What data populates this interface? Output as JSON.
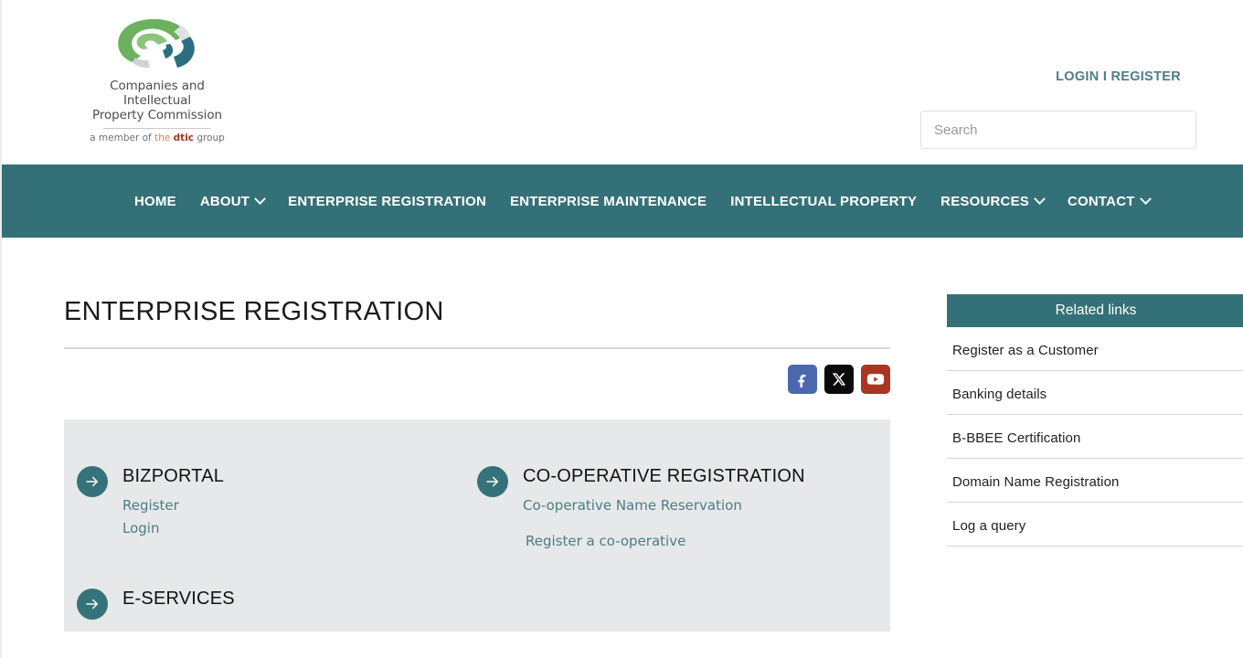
{
  "header": {
    "logo": {
      "name_line1": "Companies and Intellectual",
      "name_line2": "Property Commission",
      "tagline_prefix": "a member of ",
      "tagline_the": "the ",
      "tagline_dtic": "dtic",
      "tagline_suffix": " group",
      "icon": "cipc-swirl-logo"
    },
    "login_register": "LOGIN I REGISTER",
    "search": {
      "placeholder": "Search",
      "value": ""
    }
  },
  "nav": {
    "items": [
      {
        "label": "HOME",
        "has_caret": false
      },
      {
        "label": "ABOUT",
        "has_caret": true
      },
      {
        "label": "ENTERPRISE REGISTRATION",
        "has_caret": false
      },
      {
        "label": "ENTERPRISE MAINTENANCE",
        "has_caret": false
      },
      {
        "label": "INTELLECTUAL PROPERTY",
        "has_caret": false
      },
      {
        "label": "RESOURCES",
        "has_caret": true
      },
      {
        "label": "CONTACT",
        "has_caret": true
      }
    ]
  },
  "main": {
    "page_title": "ENTERPRISE REGISTRATION",
    "social": [
      {
        "name": "facebook",
        "label": "f",
        "color": "#4b68ad"
      },
      {
        "name": "x-twitter",
        "label": "X",
        "color": "#0b0b0b"
      },
      {
        "name": "youtube",
        "label": "▶",
        "color": "#a93621"
      }
    ],
    "services_left": [
      {
        "title": "BIZPORTAL",
        "links": [
          {
            "label": "Register",
            "indent": false
          },
          {
            "label": "Login",
            "indent": false
          }
        ]
      },
      {
        "title": "E-SERVICES",
        "links": []
      }
    ],
    "services_right": [
      {
        "title": "CO-OPERATIVE REGISTRATION",
        "links": [
          {
            "label": "Co-operative Name Reservation",
            "indent": false
          },
          {
            "label": "Register a co-operative",
            "indent": true
          }
        ]
      }
    ]
  },
  "sidebar": {
    "title": "Related links",
    "links": [
      "Register as a Customer",
      "Banking details",
      "B-BBEE Certification",
      "Domain Name Registration",
      "Log a query"
    ]
  },
  "colors": {
    "teal": "#347077",
    "link_teal": "#4a7d85",
    "panel_grey": "#e7e8e9"
  }
}
